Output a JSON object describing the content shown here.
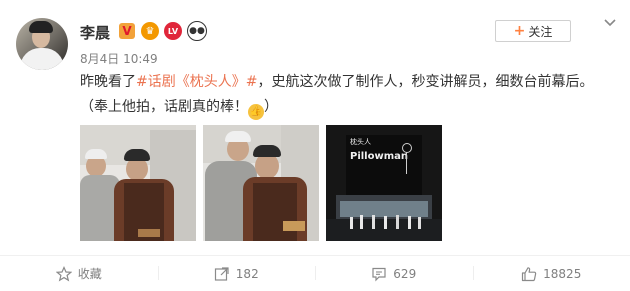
{
  "post": {
    "author": "李晨",
    "timestamp": "8月4日 10:49",
    "follow_label": "关注",
    "text_part1": "昨晚看了",
    "hashtag": "#话剧《枕头人》#",
    "text_part2": "，史航这次做了制作人，秒变讲解员，细数台前幕后。（奉上他拍，话剧真的棒！",
    "text_end": "）",
    "stage_title": "枕头人",
    "stage_subtitle": "Pillowman"
  },
  "actions": {
    "favorite_label": "收藏",
    "repost_count": "182",
    "comment_count": "629",
    "like_count": "18825"
  },
  "colors": {
    "link": "#eb7350",
    "accent": "#ff8140",
    "muted": "#808080"
  }
}
